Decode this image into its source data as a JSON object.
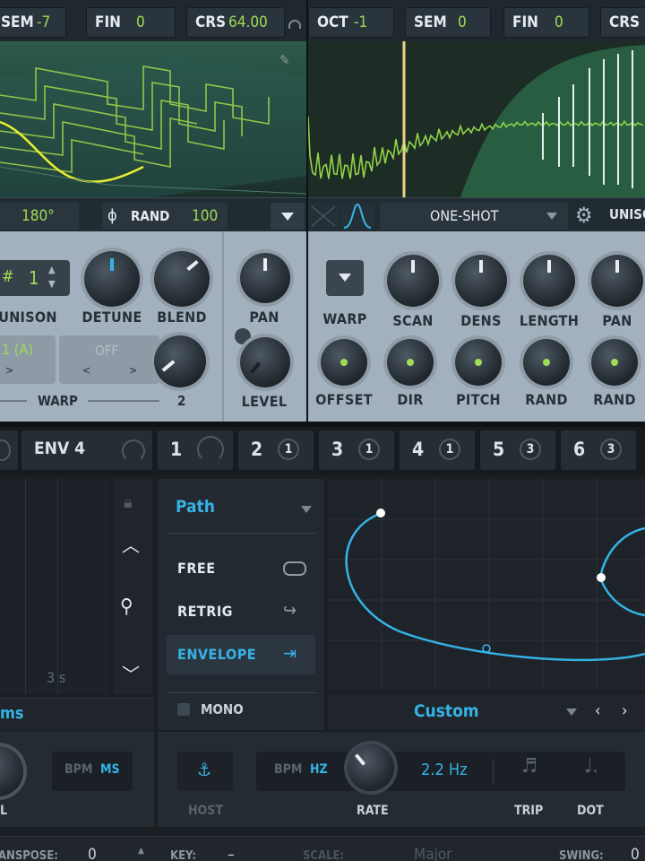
{
  "osc_a": {
    "sem_label": "SEM",
    "sem_value": "-7",
    "fin_label": "FIN",
    "fin_value": "0",
    "crs_label": "CRS",
    "crs_value": "64.00",
    "phase_value": "180°",
    "rand_label": "RAND",
    "rand_value": "100",
    "unison_label": "UNISON",
    "unison_value": "1",
    "detune_label": "DETUNE",
    "blend_label": "BLEND",
    "pan_label": "PAN",
    "level_label": "LEVEL",
    "warp_mode_value": "1 (A)",
    "warp_off_value": "OFF",
    "warp_label": "WARP",
    "warp_knob_value": "2"
  },
  "osc_b": {
    "oct_label": "OCT",
    "oct_value": "-1",
    "sem_label": "SEM",
    "sem_value": "0",
    "fin_label": "FIN",
    "fin_value": "0",
    "crs_label": "CRS",
    "mode_value": "ONE-SHOT",
    "unison_label": "UNISO",
    "knob_labels_row1": [
      "WARP",
      "SCAN",
      "DENS",
      "LENGTH",
      "PAN"
    ],
    "knob_labels_row2": [
      "OFFSET",
      "DIR",
      "PITCH",
      "RAND",
      "RAND"
    ]
  },
  "mod_tabs": {
    "env4_label": "ENV 4",
    "lfo_tabs": [
      {
        "num": "1",
        "count": ""
      },
      {
        "num": "2",
        "count": "1"
      },
      {
        "num": "3",
        "count": "1"
      },
      {
        "num": "4",
        "count": "1"
      },
      {
        "num": "5",
        "count": "3"
      },
      {
        "num": "6",
        "count": "3"
      }
    ]
  },
  "envelope": {
    "time_label": "3 s",
    "time_unit": "ms",
    "bpm_label": "BPM",
    "ms_label": "MS",
    "knob_label": "L"
  },
  "lfo": {
    "mode_select": "Path",
    "menu": [
      {
        "label": "FREE",
        "icon": "free-loop-icon"
      },
      {
        "label": "RETRIG",
        "icon": "retrig-arrow-icon"
      },
      {
        "label": "ENVELOPE",
        "icon": "envelope-arrow-icon"
      }
    ],
    "mono_label": "MONO",
    "shape_select": "Custom",
    "host_label": "HOST",
    "bpm_label": "BPM",
    "hz_label": "HZ",
    "rate_value": "2.2 Hz",
    "rate_label": "RATE",
    "trip_label": "TRIP",
    "dot_label": "DOT"
  },
  "bottom_bar": {
    "transpose_label": "ANSPOSE:",
    "transpose_value": "0",
    "key_label": "KEY:",
    "key_value": "–",
    "scale_label": "SCALE:",
    "scale_value": "Major",
    "swing_label": "SWING:",
    "swing_value": "0"
  },
  "colors": {
    "accent_blue": "#35b3e6",
    "accent_green": "#9fdc54",
    "panel_grey": "#a3b0bd"
  }
}
